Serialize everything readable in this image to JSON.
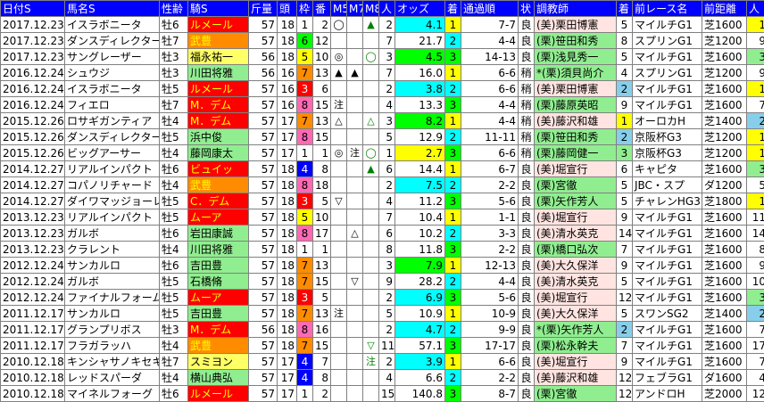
{
  "columns": [
    "日付S",
    "馬名S",
    "性齢",
    "騎S",
    "斤量",
    "頭",
    "枠",
    "番",
    "M5",
    "M7",
    "M8",
    "人",
    "オッズ",
    "着",
    "通過順",
    "状",
    "調教師",
    "着",
    "前レース名",
    "前距離",
    "人"
  ],
  "palette": {
    "jockey_red": "#FF0000",
    "jockey_orange": "#FF8C00",
    "jockey_yellow": "#FFFF66",
    "jockey_green": "#90EE90",
    "waku": {
      "1": "#FFFFFF",
      "2": "#000000",
      "3": "#FF0000",
      "4": "#0000FF",
      "5": "#FFFF00",
      "6": "#00FF00",
      "7": "#FF8C00",
      "8": "#FF69B4"
    },
    "pop": {
      "1": "#FFFF00",
      "2": "#00FFFF",
      "3": "#00FF00",
      "4": "#FFFFFF"
    },
    "trainer_east": "#FFE4E1",
    "trainer_west": "#90EE90",
    "cyan": "#00FFFF",
    "pink": "#FFC0CB",
    "prev_pop": {
      "1": "#FFFF00",
      "2": "#87CEEB",
      "3": "#90EE90"
    },
    "border": "#808080",
    "header_bg": "#0000FF"
  },
  "rows": [
    {
      "date": "2017.12.23",
      "horse": "イスラボニータ",
      "sexage": "牡6",
      "jockey": "ルメール",
      "jcolor": "red",
      "weight": "57",
      "heads": "18",
      "waku": "1",
      "num": "2",
      "m5": "◯",
      "m7": "",
      "m8": "▲",
      "pop": "2",
      "odds": "4.1",
      "place": "1",
      "pass": "7-7",
      "track": "良",
      "trainer": "(美)栗田博憲",
      "tcolor": "east",
      "prev_place": "5",
      "prev_race": "マイルチG1",
      "prev_dist": "芝1600",
      "prev_pop": "1"
    },
    {
      "date": "2017.12.23",
      "horse": "ダンスディレクター",
      "sexage": "牡7",
      "jockey": "武豊",
      "jcolor": "orange",
      "weight": "57",
      "heads": "18",
      "waku": "6",
      "num": "12",
      "m5": "",
      "m7": "",
      "m8": "",
      "pop": "7",
      "odds": "21.7",
      "place": "2",
      "pass": "4-4",
      "track": "良",
      "trainer": "(栗)笹田和秀",
      "tcolor": "west",
      "prev_place": "8",
      "prev_race": "スプリンG1",
      "prev_dist": "芝1200",
      "prev_pop": "9"
    },
    {
      "date": "2017.12.23",
      "horse": "サングレーザー",
      "sexage": "牡3",
      "jockey": "福永祐一",
      "jcolor": "yellow",
      "weight": "56",
      "heads": "18",
      "waku": "5",
      "num": "10",
      "m5": "◎",
      "m7": "",
      "m8": "◯",
      "pop": "3",
      "odds": "4.5",
      "place": "3",
      "pass": "14-13",
      "track": "良",
      "trainer": "(栗)浅見秀一",
      "tcolor": "west",
      "prev_place": "5",
      "prev_race": "マイルチG1",
      "prev_dist": "芝1600",
      "prev_pop": "3"
    },
    {
      "date": "2016.12.24",
      "horse": "シュウジ",
      "sexage": "牡3",
      "jockey": "川田将雅",
      "jcolor": "green",
      "weight": "56",
      "heads": "16",
      "waku": "7",
      "num": "13",
      "m5": "▲",
      "m7": "▲",
      "m8": "",
      "pop": "7",
      "odds": "16.0",
      "place": "1",
      "pass": "6-6",
      "track": "稍",
      "trainer": "*(栗)須貝尚介",
      "tcolor": "west",
      "prev_place": "4",
      "prev_race": "スプリンG1",
      "prev_dist": "芝1200",
      "prev_pop": "9"
    },
    {
      "date": "2016.12.24",
      "horse": "イスラボニータ",
      "sexage": "牡5",
      "jockey": "ルメール",
      "jcolor": "red",
      "weight": "57",
      "heads": "16",
      "waku": "3",
      "num": "6",
      "m5": "",
      "m7": "",
      "m8": "",
      "pop": "2",
      "odds": "3.8",
      "place": "2",
      "pass": "6-6",
      "track": "稍",
      "trainer": "(美)栗田博憲",
      "tcolor": "east",
      "prev_place": "2",
      "prev_race": "マイルチG1",
      "prev_dist": "芝1600",
      "prev_pop": "1"
    },
    {
      "date": "2016.12.24",
      "horse": "フィエロ",
      "sexage": "牡7",
      "jockey": "M．デム",
      "jcolor": "red",
      "weight": "57",
      "heads": "16",
      "waku": "8",
      "num": "15",
      "m5": "注",
      "m7": "",
      "m8": "",
      "pop": "4",
      "odds": "13.3",
      "place": "3",
      "pass": "4-4",
      "track": "稍",
      "trainer": "(栗)藤原英昭",
      "tcolor": "west",
      "prev_place": "9",
      "prev_race": "マイルチG1",
      "prev_dist": "芝1600",
      "prev_pop": "7"
    },
    {
      "date": "2015.12.26",
      "horse": "ロサギガンティア",
      "sexage": "牡4",
      "jockey": "M．デム",
      "jcolor": "red",
      "weight": "57",
      "heads": "17",
      "waku": "7",
      "num": "13",
      "m5": "△",
      "m7": "",
      "m8": "△",
      "pop": "3",
      "odds": "8.2",
      "place": "1",
      "pass": "4-4",
      "track": "稍",
      "trainer": "(美)藤沢和雄",
      "tcolor": "east",
      "prev_place": "1",
      "prev_race": "オーロカH",
      "prev_dist": "芝1400",
      "prev_pop": "2"
    },
    {
      "date": "2015.12.26",
      "horse": "ダンスディレクター",
      "sexage": "牡5",
      "jockey": "浜中俊",
      "jcolor": "green",
      "weight": "57",
      "heads": "17",
      "waku": "8",
      "num": "15",
      "m5": "",
      "m7": "",
      "m8": "",
      "pop": "5",
      "odds": "12.9",
      "place": "2",
      "pass": "11-11",
      "track": "稍",
      "trainer": "(栗)笹田和秀",
      "tcolor": "west",
      "prev_place": "2",
      "prev_race": "京阪杯G3",
      "prev_dist": "芝1200",
      "prev_pop": "1"
    },
    {
      "date": "2015.12.26",
      "horse": "ビッグアーサー",
      "sexage": "牡4",
      "jockey": "藤岡康太",
      "jcolor": "green",
      "weight": "57",
      "heads": "17",
      "waku": "1",
      "num": "1",
      "m5": "◎",
      "m7": "注",
      "m8": "◯",
      "pop": "1",
      "odds": "2.7",
      "place": "3",
      "pass": "6-6",
      "track": "稍",
      "trainer": "(栗)藤岡健一",
      "tcolor": "west",
      "prev_place": "3",
      "prev_race": "京阪杯G3",
      "prev_dist": "芝1200",
      "prev_pop": "1"
    },
    {
      "date": "2014.12.27",
      "horse": "リアルインパクト",
      "sexage": "牡6",
      "jockey": "ビュイッ",
      "jcolor": "red",
      "weight": "57",
      "heads": "18",
      "waku": "4",
      "num": "8",
      "m5": "",
      "m7": "",
      "m8": "▲",
      "pop": "6",
      "odds": "14.4",
      "place": "1",
      "pass": "6-7",
      "track": "良",
      "trainer": "(美)堀宣行",
      "tcolor": "east",
      "prev_place": "6",
      "prev_race": "キャピタ",
      "prev_dist": "芝1600",
      "prev_pop": "3"
    },
    {
      "date": "2014.12.27",
      "horse": "コパノリチャード",
      "sexage": "牡4",
      "jockey": "武豊",
      "jcolor": "orange",
      "weight": "57",
      "heads": "18",
      "waku": "8",
      "num": "18",
      "m5": "",
      "m7": "",
      "m8": "",
      "pop": "2",
      "odds": "7.5",
      "place": "2",
      "pass": "2-2",
      "track": "良",
      "trainer": "(栗)宮徹",
      "tcolor": "west",
      "prev_place": "5",
      "prev_race": "JBC・スプ",
      "prev_dist": "ダ1200",
      "prev_pop": "5"
    },
    {
      "date": "2014.12.27",
      "horse": "ダイワマッジョーレ",
      "sexage": "牡5",
      "jockey": "C．デム",
      "jcolor": "red",
      "weight": "57",
      "heads": "18",
      "waku": "3",
      "num": "5",
      "m5": "▽",
      "m7": "",
      "m8": "",
      "pop": "4",
      "odds": "11.2",
      "place": "3",
      "pass": "5-6",
      "track": "良",
      "trainer": "(栗)矢作芳人",
      "tcolor": "west",
      "prev_place": "5",
      "prev_race": "チャレンHG3",
      "prev_dist": "芝1800",
      "prev_pop": "1"
    },
    {
      "date": "2013.12.23",
      "horse": "リアルインパクト",
      "sexage": "牡5",
      "jockey": "ムーア",
      "jcolor": "red",
      "weight": "57",
      "heads": "18",
      "waku": "5",
      "num": "10",
      "m5": "",
      "m7": "",
      "m8": "",
      "pop": "7",
      "odds": "10.4",
      "place": "1",
      "pass": "1-1",
      "track": "良",
      "trainer": "(美)堀宣行",
      "tcolor": "east",
      "prev_place": "9",
      "prev_race": "マイルチG1",
      "prev_dist": "芝1600",
      "prev_pop": "11"
    },
    {
      "date": "2013.12.23",
      "horse": "ガルボ",
      "sexage": "牡6",
      "jockey": "岩田康誠",
      "jcolor": "green",
      "weight": "57",
      "heads": "18",
      "waku": "8",
      "num": "17",
      "m5": "",
      "m7": "△",
      "m8": "",
      "pop": "6",
      "odds": "10.2",
      "place": "2",
      "pass": "3-3",
      "track": "良",
      "trainer": "(美)清水英克",
      "tcolor": "east",
      "prev_place": "14",
      "prev_race": "マイルチG1",
      "prev_dist": "芝1600",
      "prev_pop": "14"
    },
    {
      "date": "2013.12.23",
      "horse": "クラレント",
      "sexage": "牡4",
      "jockey": "川田将雅",
      "jcolor": "green",
      "weight": "57",
      "heads": "18",
      "waku": "1",
      "num": "1",
      "m5": "",
      "m7": "",
      "m8": "",
      "pop": "8",
      "odds": "11.8",
      "place": "3",
      "pass": "2-2",
      "track": "良",
      "trainer": "(栗)橋口弘次",
      "tcolor": "west",
      "prev_place": "7",
      "prev_race": "マイルチG1",
      "prev_dist": "芝1600",
      "prev_pop": "8"
    },
    {
      "date": "2012.12.24",
      "horse": "サンカルロ",
      "sexage": "牡6",
      "jockey": "吉田豊",
      "jcolor": "green",
      "weight": "57",
      "heads": "18",
      "waku": "7",
      "num": "13",
      "m5": "",
      "m7": "",
      "m8": "",
      "pop": "3",
      "odds": "7.9",
      "place": "1",
      "pass": "12-13",
      "track": "良",
      "trainer": "(美)大久保洋",
      "tcolor": "east",
      "prev_place": "9",
      "prev_race": "マイルチG1",
      "prev_dist": "芝1600",
      "prev_pop": "9"
    },
    {
      "date": "2012.12.24",
      "horse": "ガルボ",
      "sexage": "牡5",
      "jockey": "石橋脩",
      "jcolor": "green",
      "weight": "57",
      "heads": "18",
      "waku": "7",
      "num": "15",
      "m5": "",
      "m7": "▽",
      "m8": "",
      "pop": "9",
      "odds": "28.2",
      "place": "2",
      "pass": "4-4",
      "track": "良",
      "trainer": "(美)清水英克",
      "tcolor": "east",
      "prev_place": "5",
      "prev_race": "マイルチG1",
      "prev_dist": "芝1600",
      "prev_pop": "10"
    },
    {
      "date": "2012.12.24",
      "horse": "ファイナルフォーム",
      "sexage": "牡5",
      "jockey": "ムーア",
      "jcolor": "red",
      "weight": "57",
      "heads": "18",
      "waku": "3",
      "num": "5",
      "m5": "",
      "m7": "",
      "m8": "",
      "pop": "2",
      "odds": "6.9",
      "place": "3",
      "pass": "5-6",
      "track": "良",
      "trainer": "(美)堀宣行",
      "tcolor": "east",
      "prev_place": "12",
      "prev_race": "マイルチG1",
      "prev_dist": "芝1600",
      "prev_pop": "3"
    },
    {
      "date": "2011.12.17",
      "horse": "サンカルロ",
      "sexage": "牡5",
      "jockey": "吉田豊",
      "jcolor": "green",
      "weight": "57",
      "heads": "18",
      "waku": "7",
      "num": "13",
      "m5": "注",
      "m7": "",
      "m8": "",
      "pop": "5",
      "odds": "10.9",
      "place": "1",
      "pass": "10-9",
      "track": "良",
      "trainer": "(美)大久保洋",
      "tcolor": "east",
      "prev_place": "5",
      "prev_race": "スワンSG2",
      "prev_dist": "芝1400",
      "prev_pop": "2"
    },
    {
      "date": "2011.12.17",
      "horse": "グランプリボス",
      "sexage": "牡3",
      "jockey": "M．デム",
      "jcolor": "red",
      "weight": "56",
      "heads": "18",
      "waku": "8",
      "num": "16",
      "m5": "",
      "m7": "",
      "m8": "",
      "pop": "2",
      "odds": "4.7",
      "place": "2",
      "pass": "9-9",
      "track": "良",
      "trainer": "*(栗)矢作芳人",
      "tcolor": "west",
      "prev_place": "2",
      "prev_race": "マイルチG1",
      "prev_dist": "芝1600",
      "prev_pop": "7"
    },
    {
      "date": "2011.12.17",
      "horse": "フラガラッハ",
      "sexage": "牡4",
      "jockey": "武豊",
      "jcolor": "orange",
      "weight": "57",
      "heads": "18",
      "waku": "7",
      "num": "15",
      "m5": "",
      "m7": "",
      "m8": "▽",
      "pop": "11",
      "odds": "57.1",
      "place": "3",
      "pass": "17-17",
      "track": "良",
      "trainer": "(栗)松永幹夫",
      "tcolor": "west",
      "prev_place": "7",
      "prev_race": "マイルチG1",
      "prev_dist": "芝1600",
      "prev_pop": "17"
    },
    {
      "date": "2010.12.18",
      "horse": "キンシャサノキセキ",
      "sexage": "牡7",
      "jockey": "スミヨン",
      "jcolor": "yellow",
      "weight": "57",
      "heads": "17",
      "waku": "4",
      "num": "7",
      "m5": "",
      "m7": "",
      "m8": "注",
      "pop": "2",
      "odds": "3.9",
      "place": "1",
      "pass": "6-6",
      "track": "良",
      "trainer": "(美)堀宣行",
      "tcolor": "east",
      "prev_place": "9",
      "prev_race": "マイルチG1",
      "prev_dist": "芝1600",
      "prev_pop": "7"
    },
    {
      "date": "2010.12.18",
      "horse": "レッドスパーダ",
      "sexage": "牡4",
      "jockey": "横山典弘",
      "jcolor": "green",
      "weight": "57",
      "heads": "17",
      "waku": "4",
      "num": "8",
      "m5": "",
      "m7": "",
      "m8": "",
      "pop": "4",
      "odds": "6.6",
      "place": "2",
      "pass": "2-2",
      "track": "良",
      "trainer": "(美)藤沢和雄",
      "tcolor": "east",
      "prev_place": "12",
      "prev_race": "フェブラG1",
      "prev_dist": "ダ1600",
      "prev_pop": "4"
    },
    {
      "date": "2010.12.18",
      "horse": "マイネルフォーグ",
      "sexage": "牡6",
      "jockey": "ルメール",
      "jcolor": "red",
      "weight": "57",
      "heads": "17",
      "waku": "1",
      "num": "2",
      "m5": "",
      "m7": "",
      "m8": "",
      "pop": "15",
      "odds": "140.8",
      "place": "3",
      "pass": "8-7",
      "track": "良",
      "trainer": "(栗)宮徹",
      "tcolor": "west",
      "prev_place": "12",
      "prev_race": "アンドロH",
      "prev_dist": "芝2000",
      "prev_pop": "12"
    }
  ]
}
